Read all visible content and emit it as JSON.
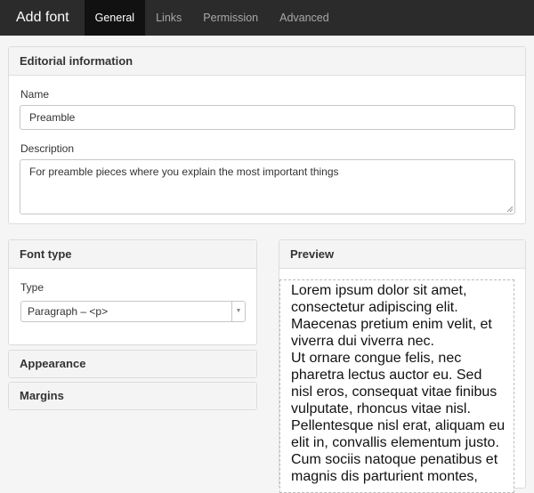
{
  "topbar": {
    "title": "Add font",
    "tabs": [
      {
        "label": "General",
        "active": true
      },
      {
        "label": "Links",
        "active": false
      },
      {
        "label": "Permission",
        "active": false
      },
      {
        "label": "Advanced",
        "active": false
      }
    ]
  },
  "editorial": {
    "heading": "Editorial information",
    "name_label": "Name",
    "name_value": "Preamble",
    "description_label": "Description",
    "description_value": "For preamble pieces where you explain the most important things"
  },
  "font_type": {
    "heading": "Font type",
    "type_label": "Type",
    "type_value": "Paragraph – <p>"
  },
  "appearance": {
    "heading": "Appearance"
  },
  "margins": {
    "heading": "Margins"
  },
  "preview": {
    "heading": "Preview",
    "lines": [
      "Lorem ipsum dolor sit amet,",
      "consectetur adipiscing elit.",
      "Maecenas pretium enim velit, et",
      "viverra dui viverra nec.",
      "Ut ornare congue felis, nec",
      "pharetra lectus auctor eu. Sed",
      "nisl eros, consequat vitae finibus",
      "vulputate, rhoncus vitae nisl.",
      "Pellentesque nisl erat, aliquam eu",
      "elit in, convallis elementum justo.",
      "Cum sociis natoque penatibus et",
      "magnis dis parturient montes,"
    ]
  },
  "colors": {
    "topbar_bg": "#2b2b2b",
    "active_tab_bg": "#111111",
    "panel_header_bg": "#f4f4f4"
  }
}
